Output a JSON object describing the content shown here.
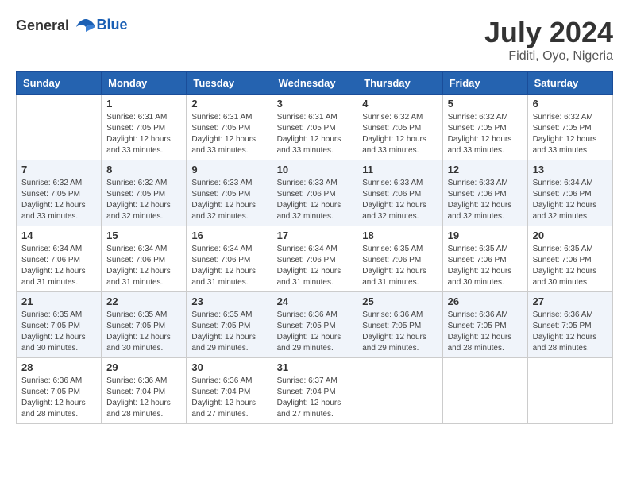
{
  "header": {
    "logo_general": "General",
    "logo_blue": "Blue",
    "month_year": "July 2024",
    "location": "Fiditi, Oyo, Nigeria"
  },
  "days_of_week": [
    "Sunday",
    "Monday",
    "Tuesday",
    "Wednesday",
    "Thursday",
    "Friday",
    "Saturday"
  ],
  "weeks": [
    [
      {
        "day": "",
        "sunrise": "",
        "sunset": "",
        "daylight": ""
      },
      {
        "day": "1",
        "sunrise": "Sunrise: 6:31 AM",
        "sunset": "Sunset: 7:05 PM",
        "daylight": "Daylight: 12 hours and 33 minutes."
      },
      {
        "day": "2",
        "sunrise": "Sunrise: 6:31 AM",
        "sunset": "Sunset: 7:05 PM",
        "daylight": "Daylight: 12 hours and 33 minutes."
      },
      {
        "day": "3",
        "sunrise": "Sunrise: 6:31 AM",
        "sunset": "Sunset: 7:05 PM",
        "daylight": "Daylight: 12 hours and 33 minutes."
      },
      {
        "day": "4",
        "sunrise": "Sunrise: 6:32 AM",
        "sunset": "Sunset: 7:05 PM",
        "daylight": "Daylight: 12 hours and 33 minutes."
      },
      {
        "day": "5",
        "sunrise": "Sunrise: 6:32 AM",
        "sunset": "Sunset: 7:05 PM",
        "daylight": "Daylight: 12 hours and 33 minutes."
      },
      {
        "day": "6",
        "sunrise": "Sunrise: 6:32 AM",
        "sunset": "Sunset: 7:05 PM",
        "daylight": "Daylight: 12 hours and 33 minutes."
      }
    ],
    [
      {
        "day": "7",
        "sunrise": "Sunrise: 6:32 AM",
        "sunset": "Sunset: 7:05 PM",
        "daylight": "Daylight: 12 hours and 33 minutes."
      },
      {
        "day": "8",
        "sunrise": "Sunrise: 6:32 AM",
        "sunset": "Sunset: 7:05 PM",
        "daylight": "Daylight: 12 hours and 32 minutes."
      },
      {
        "day": "9",
        "sunrise": "Sunrise: 6:33 AM",
        "sunset": "Sunset: 7:05 PM",
        "daylight": "Daylight: 12 hours and 32 minutes."
      },
      {
        "day": "10",
        "sunrise": "Sunrise: 6:33 AM",
        "sunset": "Sunset: 7:06 PM",
        "daylight": "Daylight: 12 hours and 32 minutes."
      },
      {
        "day": "11",
        "sunrise": "Sunrise: 6:33 AM",
        "sunset": "Sunset: 7:06 PM",
        "daylight": "Daylight: 12 hours and 32 minutes."
      },
      {
        "day": "12",
        "sunrise": "Sunrise: 6:33 AM",
        "sunset": "Sunset: 7:06 PM",
        "daylight": "Daylight: 12 hours and 32 minutes."
      },
      {
        "day": "13",
        "sunrise": "Sunrise: 6:34 AM",
        "sunset": "Sunset: 7:06 PM",
        "daylight": "Daylight: 12 hours and 32 minutes."
      }
    ],
    [
      {
        "day": "14",
        "sunrise": "Sunrise: 6:34 AM",
        "sunset": "Sunset: 7:06 PM",
        "daylight": "Daylight: 12 hours and 31 minutes."
      },
      {
        "day": "15",
        "sunrise": "Sunrise: 6:34 AM",
        "sunset": "Sunset: 7:06 PM",
        "daylight": "Daylight: 12 hours and 31 minutes."
      },
      {
        "day": "16",
        "sunrise": "Sunrise: 6:34 AM",
        "sunset": "Sunset: 7:06 PM",
        "daylight": "Daylight: 12 hours and 31 minutes."
      },
      {
        "day": "17",
        "sunrise": "Sunrise: 6:34 AM",
        "sunset": "Sunset: 7:06 PM",
        "daylight": "Daylight: 12 hours and 31 minutes."
      },
      {
        "day": "18",
        "sunrise": "Sunrise: 6:35 AM",
        "sunset": "Sunset: 7:06 PM",
        "daylight": "Daylight: 12 hours and 31 minutes."
      },
      {
        "day": "19",
        "sunrise": "Sunrise: 6:35 AM",
        "sunset": "Sunset: 7:06 PM",
        "daylight": "Daylight: 12 hours and 30 minutes."
      },
      {
        "day": "20",
        "sunrise": "Sunrise: 6:35 AM",
        "sunset": "Sunset: 7:06 PM",
        "daylight": "Daylight: 12 hours and 30 minutes."
      }
    ],
    [
      {
        "day": "21",
        "sunrise": "Sunrise: 6:35 AM",
        "sunset": "Sunset: 7:05 PM",
        "daylight": "Daylight: 12 hours and 30 minutes."
      },
      {
        "day": "22",
        "sunrise": "Sunrise: 6:35 AM",
        "sunset": "Sunset: 7:05 PM",
        "daylight": "Daylight: 12 hours and 30 minutes."
      },
      {
        "day": "23",
        "sunrise": "Sunrise: 6:35 AM",
        "sunset": "Sunset: 7:05 PM",
        "daylight": "Daylight: 12 hours and 29 minutes."
      },
      {
        "day": "24",
        "sunrise": "Sunrise: 6:36 AM",
        "sunset": "Sunset: 7:05 PM",
        "daylight": "Daylight: 12 hours and 29 minutes."
      },
      {
        "day": "25",
        "sunrise": "Sunrise: 6:36 AM",
        "sunset": "Sunset: 7:05 PM",
        "daylight": "Daylight: 12 hours and 29 minutes."
      },
      {
        "day": "26",
        "sunrise": "Sunrise: 6:36 AM",
        "sunset": "Sunset: 7:05 PM",
        "daylight": "Daylight: 12 hours and 28 minutes."
      },
      {
        "day": "27",
        "sunrise": "Sunrise: 6:36 AM",
        "sunset": "Sunset: 7:05 PM",
        "daylight": "Daylight: 12 hours and 28 minutes."
      }
    ],
    [
      {
        "day": "28",
        "sunrise": "Sunrise: 6:36 AM",
        "sunset": "Sunset: 7:05 PM",
        "daylight": "Daylight: 12 hours and 28 minutes."
      },
      {
        "day": "29",
        "sunrise": "Sunrise: 6:36 AM",
        "sunset": "Sunset: 7:04 PM",
        "daylight": "Daylight: 12 hours and 28 minutes."
      },
      {
        "day": "30",
        "sunrise": "Sunrise: 6:36 AM",
        "sunset": "Sunset: 7:04 PM",
        "daylight": "Daylight: 12 hours and 27 minutes."
      },
      {
        "day": "31",
        "sunrise": "Sunrise: 6:37 AM",
        "sunset": "Sunset: 7:04 PM",
        "daylight": "Daylight: 12 hours and 27 minutes."
      },
      {
        "day": "",
        "sunrise": "",
        "sunset": "",
        "daylight": ""
      },
      {
        "day": "",
        "sunrise": "",
        "sunset": "",
        "daylight": ""
      },
      {
        "day": "",
        "sunrise": "",
        "sunset": "",
        "daylight": ""
      }
    ]
  ]
}
